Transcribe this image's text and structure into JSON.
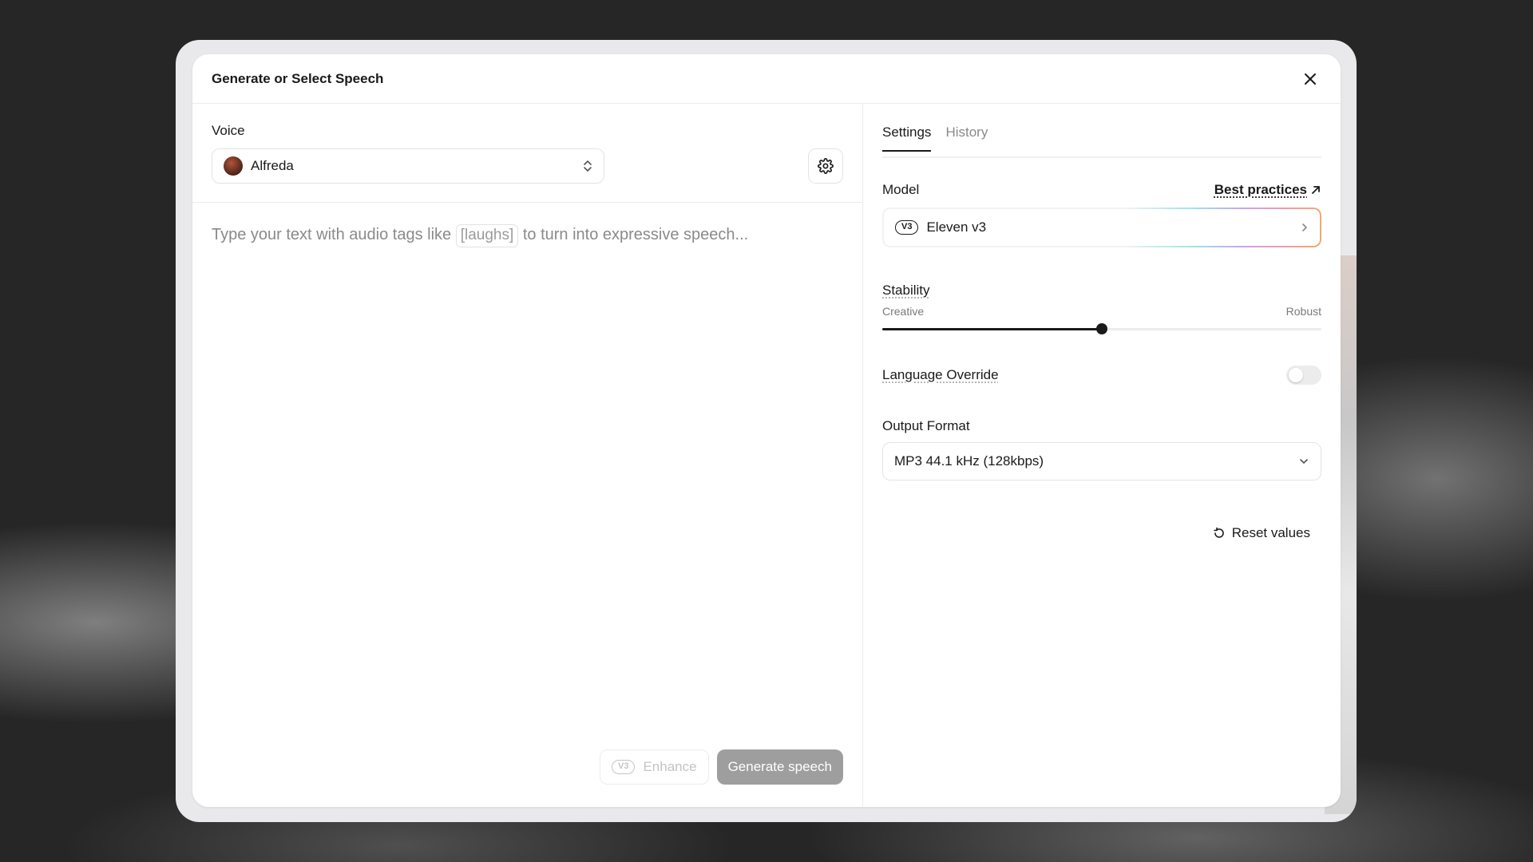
{
  "dialog": {
    "title": "Generate or Select Speech"
  },
  "voice": {
    "label": "Voice",
    "selected": "Alfreda"
  },
  "editor": {
    "placeholder_before": "Type your text with audio tags like",
    "placeholder_tag": "[laughs]",
    "placeholder_after": "to turn into expressive speech..."
  },
  "actions": {
    "enhance_badge": "V3",
    "enhance_label": "Enhance",
    "generate_label": "Generate speech"
  },
  "tabs": [
    {
      "label": "Settings",
      "active": true
    },
    {
      "label": "History",
      "active": false
    }
  ],
  "model": {
    "label": "Model",
    "best_practices": "Best practices",
    "badge": "V3",
    "name": "Eleven v3"
  },
  "stability": {
    "label": "Stability",
    "min_label": "Creative",
    "max_label": "Robust",
    "value": 0.5
  },
  "language_override": {
    "label": "Language Override",
    "enabled": false
  },
  "output_format": {
    "label": "Output Format",
    "selected": "MP3 44.1 kHz (128kbps)"
  },
  "reset": {
    "label": "Reset values"
  },
  "icons": {
    "close": "close-icon",
    "settings": "gear-icon",
    "updown": "chevron-up-down-icon",
    "arrow": "arrow-up-right-icon",
    "chevron_right": "chevron-right-icon",
    "chevron_down": "chevron-down-icon",
    "reset": "rotate-ccw-icon"
  }
}
